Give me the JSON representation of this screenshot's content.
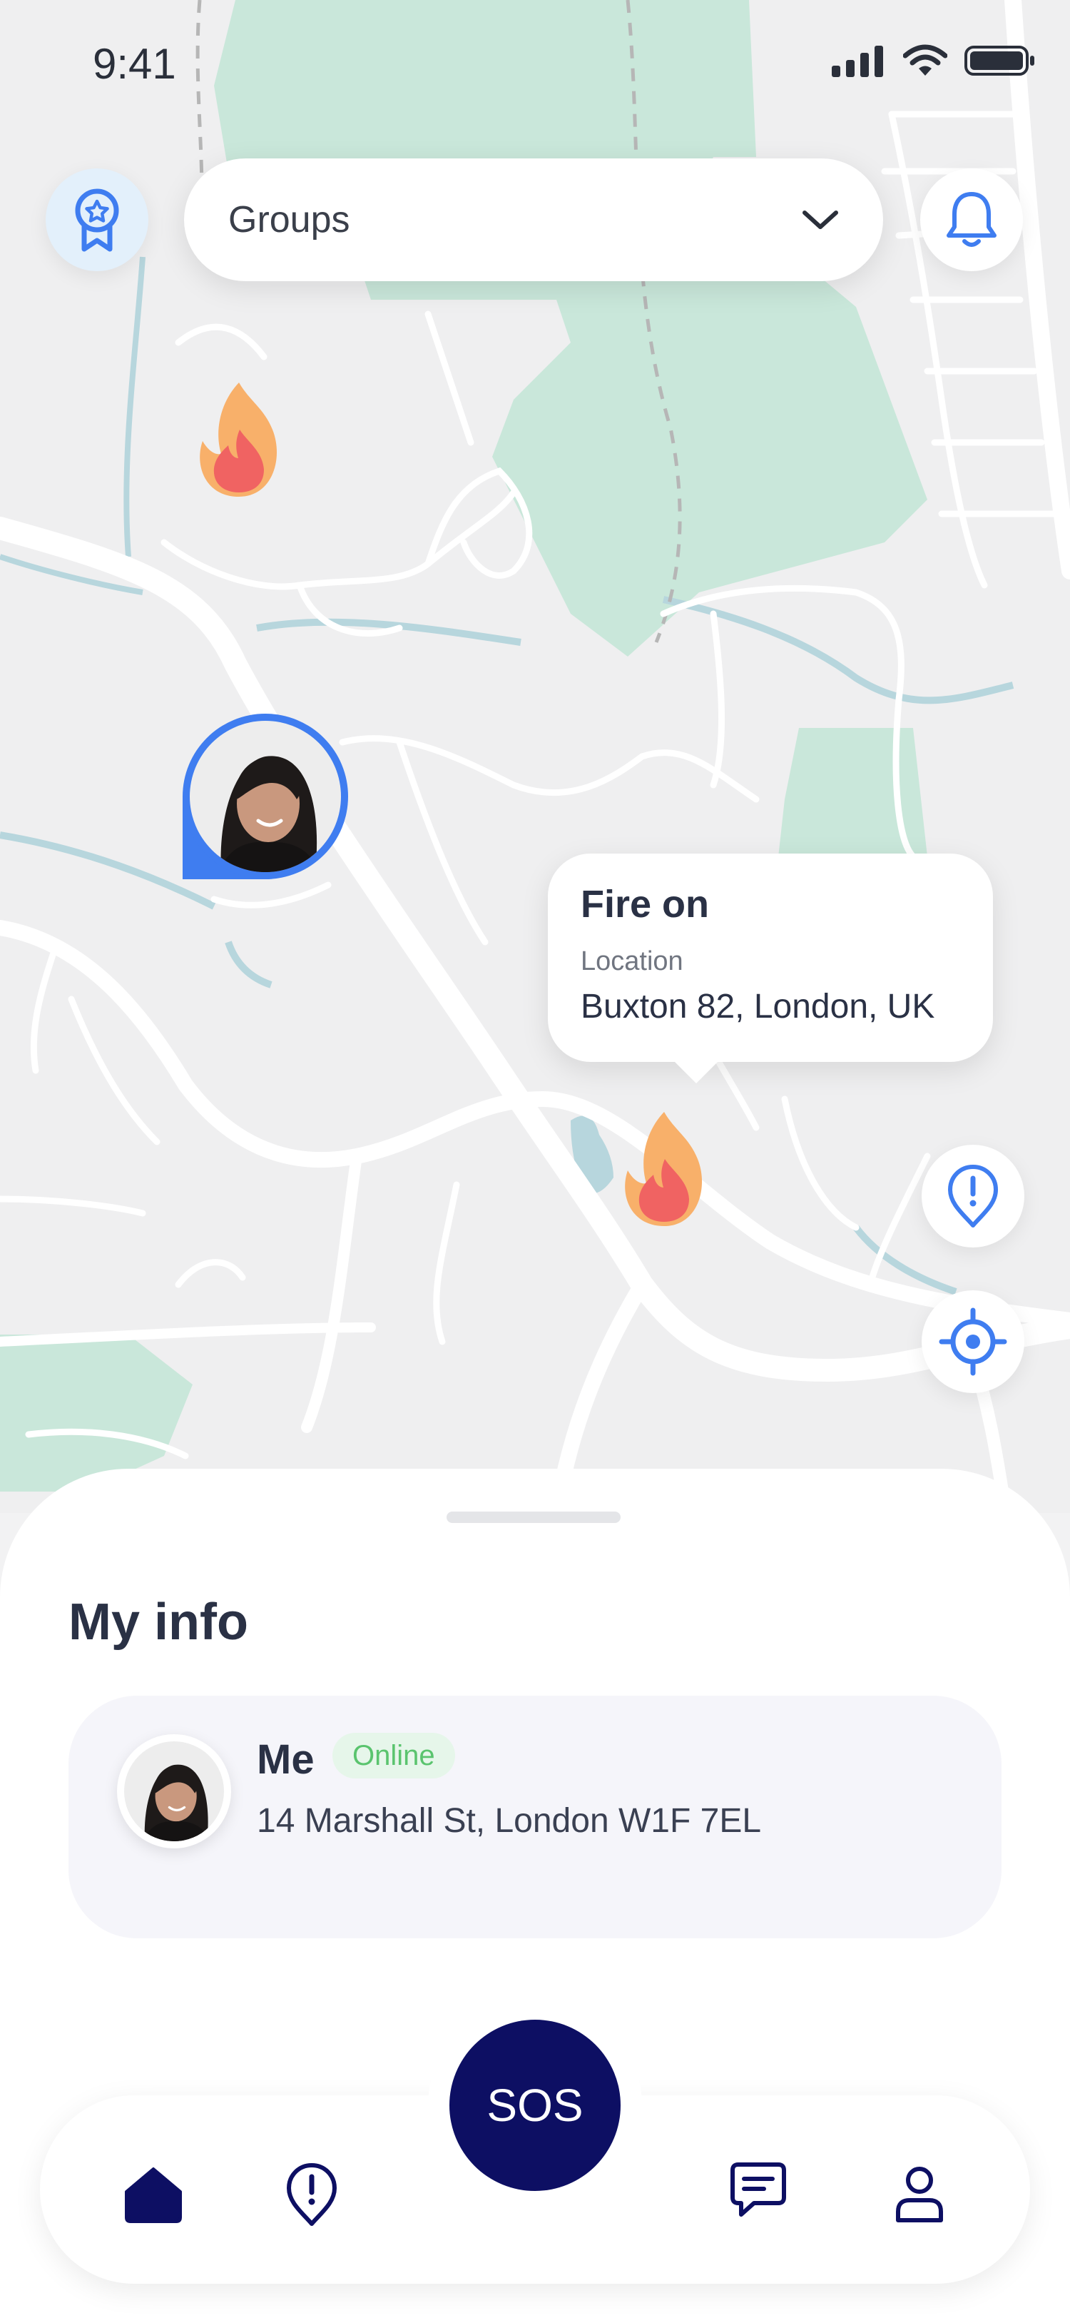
{
  "status_bar": {
    "time": "9:41"
  },
  "header": {
    "groups_label": "Groups"
  },
  "tooltip": {
    "title": "Fire on",
    "location_label": "Location",
    "address": "Buxton 82, London, UK"
  },
  "sheet": {
    "title": "My info",
    "card": {
      "name": "Me",
      "status": "Online",
      "address": "14 Marshall St, London W1F 7EL"
    }
  },
  "nav": {
    "sos_label": "SOS"
  },
  "colors": {
    "accent": "#3f7df0",
    "sos": "#0d0f63",
    "online_text": "#5ac46e",
    "online_bg": "#e6f6ea",
    "park": "#c9e7da",
    "water": "#b7d6dd"
  },
  "icons": [
    "badge-icon",
    "chevron-down-icon",
    "bell-icon",
    "fire-icon",
    "alert-pin-icon",
    "locate-icon",
    "home-icon",
    "chat-icon",
    "profile-icon"
  ]
}
